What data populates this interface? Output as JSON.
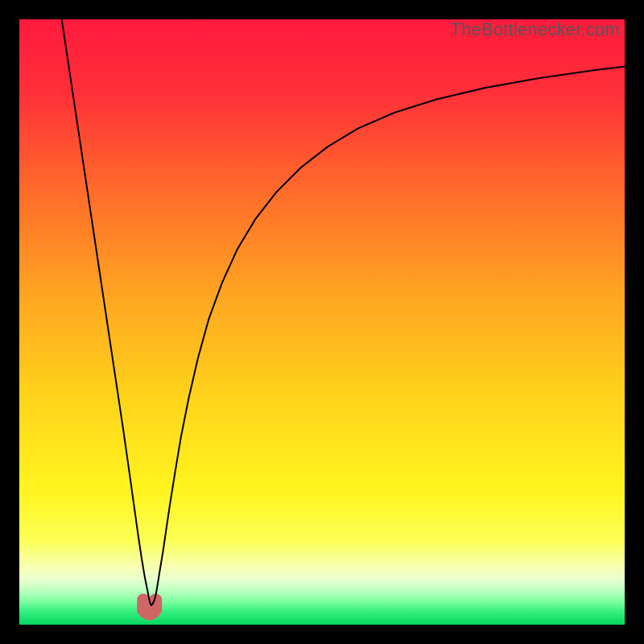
{
  "watermark": "TheBottlenecker.com",
  "chart_data": {
    "type": "line",
    "title": "",
    "xlabel": "",
    "ylabel": "",
    "xlim": [
      0,
      100
    ],
    "ylim": [
      0,
      100
    ],
    "background": {
      "type": "vertical-gradient",
      "stops": [
        {
          "pos": 0.0,
          "color": "#ff1a3d"
        },
        {
          "pos": 0.12,
          "color": "#ff2f39"
        },
        {
          "pos": 0.28,
          "color": "#ff6a2a"
        },
        {
          "pos": 0.45,
          "color": "#ffa321"
        },
        {
          "pos": 0.62,
          "color": "#ffd21a"
        },
        {
          "pos": 0.78,
          "color": "#fff41f"
        },
        {
          "pos": 0.86,
          "color": "#fcff54"
        },
        {
          "pos": 0.905,
          "color": "#f6ffb2"
        },
        {
          "pos": 0.925,
          "color": "#e9ffd0"
        },
        {
          "pos": 0.945,
          "color": "#b8ffbf"
        },
        {
          "pos": 0.962,
          "color": "#7dff9f"
        },
        {
          "pos": 0.978,
          "color": "#35f07e"
        },
        {
          "pos": 1.0,
          "color": "#06d65e"
        }
      ]
    },
    "series": [
      {
        "name": "bottleneck-curve",
        "stroke": "#000000",
        "stroke_width": 2,
        "x": [
          7.0,
          8.5,
          10.0,
          11.5,
          13.0,
          14.5,
          16.0,
          17.2,
          18.2,
          18.9,
          19.6,
          20.2,
          20.7,
          21.1,
          21.4,
          21.6,
          21.8,
          22.0,
          22.3,
          22.6,
          22.9,
          23.3,
          23.8,
          24.3,
          24.9,
          25.7,
          26.7,
          28.0,
          29.5,
          31.3,
          33.5,
          36.0,
          39.0,
          42.5,
          46.5,
          51.0,
          56.0,
          62.0,
          69.0,
          77.0,
          86.0,
          95.0,
          100.0
        ],
        "y": [
          100.0,
          90.0,
          80.0,
          70.0,
          60.0,
          50.0,
          40.0,
          32.0,
          25.0,
          20.0,
          15.0,
          11.0,
          8.0,
          6.0,
          4.5,
          3.6,
          3.2,
          3.4,
          4.0,
          5.2,
          7.0,
          9.5,
          12.5,
          16.0,
          20.0,
          25.0,
          31.0,
          37.5,
          44.0,
          50.5,
          56.5,
          62.0,
          67.0,
          71.5,
          75.5,
          79.0,
          82.0,
          84.6,
          86.8,
          88.7,
          90.3,
          91.6,
          92.2
        ]
      }
    ],
    "highlight": {
      "note": "pink rounded U-shaped marker near curve minimum",
      "color": "#cf6666",
      "points": [
        {
          "x": 20.5,
          "y": 3.0
        },
        {
          "x": 22.5,
          "y": 3.0
        }
      ],
      "thickness": 16
    }
  }
}
